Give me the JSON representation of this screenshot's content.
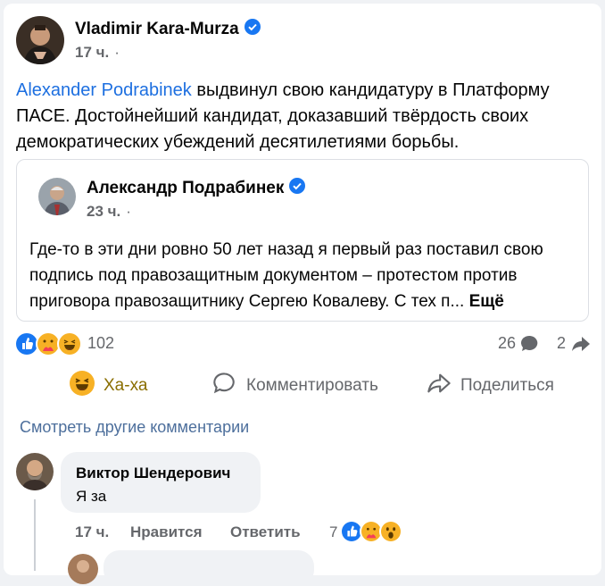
{
  "post": {
    "author": "Vladimir Kara-Murza",
    "time": "17 ч.",
    "visibility_sep": "·",
    "mention": "Alexander  Podrabinek",
    "text_after_mention": " выдвинул свою кандидатуру в Платформу ПАСЕ. Достойнейший кандидат, доказавший твёрдость своих демократических убеждений десятилетиями борьбы."
  },
  "shared": {
    "author": "Александр Подрабинек",
    "time": "23 ч.",
    "visibility_sep": "·",
    "text": "Где-то в эти дни ровно 50 лет назад я первый раз поставил свою подпись под правозащитным документом – протестом против приговора правозащитнику Сергею Ковалеву. С тех п... ",
    "more_label": "Ещё"
  },
  "stats": {
    "reactions_count": "102",
    "comments_count": "26",
    "shares_count": "2"
  },
  "actions": {
    "haha_label": "Ха-ха",
    "comment_label": "Комментировать",
    "share_label": "Поделиться"
  },
  "comments": {
    "see_more_label": "Смотреть другие комментарии",
    "first": {
      "author": "Виктор Шендерович",
      "text": "Я за",
      "time": "17 ч.",
      "like_label": "Нравится",
      "reply_label": "Ответить",
      "reactions_count": "7"
    }
  },
  "colors": {
    "accent": "#1877f2",
    "mention": "#1d6fe0",
    "secondary_text": "#65676b",
    "haha": "#f7b125"
  }
}
